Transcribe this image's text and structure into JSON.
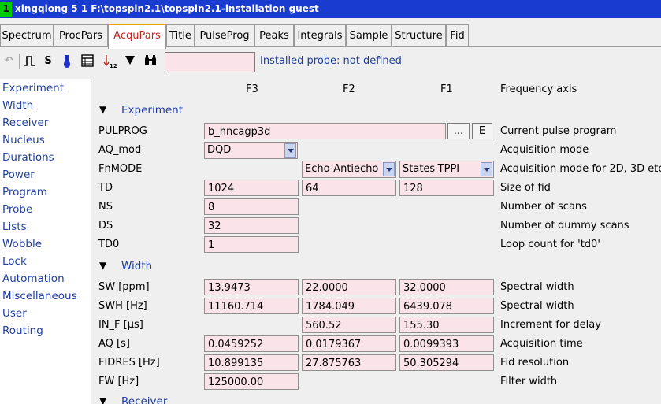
{
  "window": {
    "badge": "1",
    "title": "xingqiong  5  1  F:\\topspin2.1\\topspin2.1-installation  guest"
  },
  "tabs": [
    "Spectrum",
    "ProcPars",
    "AcquPars",
    "Title",
    "PulseProg",
    "Peaks",
    "Integrals",
    "Sample",
    "Structure",
    "Fid"
  ],
  "active_tab": "AcquPars",
  "toolbar": {
    "icons": [
      "undo-icon",
      "pulse-icon",
      "s-icon",
      "probe-tube-icon",
      "table-icon",
      "sort-icon",
      "filter-icon",
      "binoculars-icon"
    ],
    "s_label": "S",
    "search_value": "",
    "probe_status": "Installed probe: not defined"
  },
  "sidebar": [
    "Experiment",
    "Width",
    "Receiver",
    "Nucleus",
    "Durations",
    "Power",
    "Program",
    "Probe",
    "Lists",
    "Wobble",
    "Lock",
    "Automation",
    "Miscellaneous",
    "User",
    "Routing"
  ],
  "columns": {
    "f3": "F3",
    "f2": "F2",
    "f1": "F1",
    "axis": "Frequency axis"
  },
  "sections": {
    "experiment": "Experiment",
    "width": "Width",
    "receiver": "Receiver"
  },
  "params": {
    "pulprog": {
      "label": "PULPROG",
      "value": "b_hncagp3d",
      "browse": "...",
      "edit": "E",
      "desc": "Current pulse program"
    },
    "aq_mod": {
      "label": "AQ_mod",
      "value": "DQD",
      "desc": "Acquisition mode"
    },
    "fnmode": {
      "label": "FnMODE",
      "f2": "Echo-Antiecho",
      "f1": "States-TPPI",
      "desc": "Acquisition mode for 2D, 3D etc."
    },
    "td": {
      "label": "TD",
      "f3": "1024",
      "f2": "64",
      "f1": "128",
      "desc": "Size of fid"
    },
    "ns": {
      "label": "NS",
      "f3": "8",
      "desc": "Number of scans"
    },
    "ds": {
      "label": "DS",
      "f3": "32",
      "desc": "Number of dummy scans"
    },
    "td0": {
      "label": "TD0",
      "f3": "1",
      "desc": "Loop count for 'td0'"
    },
    "sw": {
      "label": "SW [ppm]",
      "f3": "13.9473",
      "f2": "22.0000",
      "f1": "32.0000",
      "desc": "Spectral width"
    },
    "swh": {
      "label": "SWH [Hz]",
      "f3": "11160.714",
      "f2": "1784.049",
      "f1": "6439.078",
      "desc": "Spectral width"
    },
    "in_f": {
      "label": "IN_F [µs]",
      "f2": "560.52",
      "f1": "155.30",
      "desc": "Increment for delay"
    },
    "aq": {
      "label": "AQ [s]",
      "f3": "0.0459252",
      "f2": "0.0179367",
      "f1": "0.0099393",
      "desc": "Acquisition time"
    },
    "fidres": {
      "label": "FIDRES [Hz]",
      "f3": "10.899135",
      "f2": "27.875763",
      "f1": "50.305294",
      "desc": "Fid resolution"
    },
    "fw": {
      "label": "FW [Hz]",
      "f3": "125000.00",
      "desc": "Filter width"
    }
  }
}
